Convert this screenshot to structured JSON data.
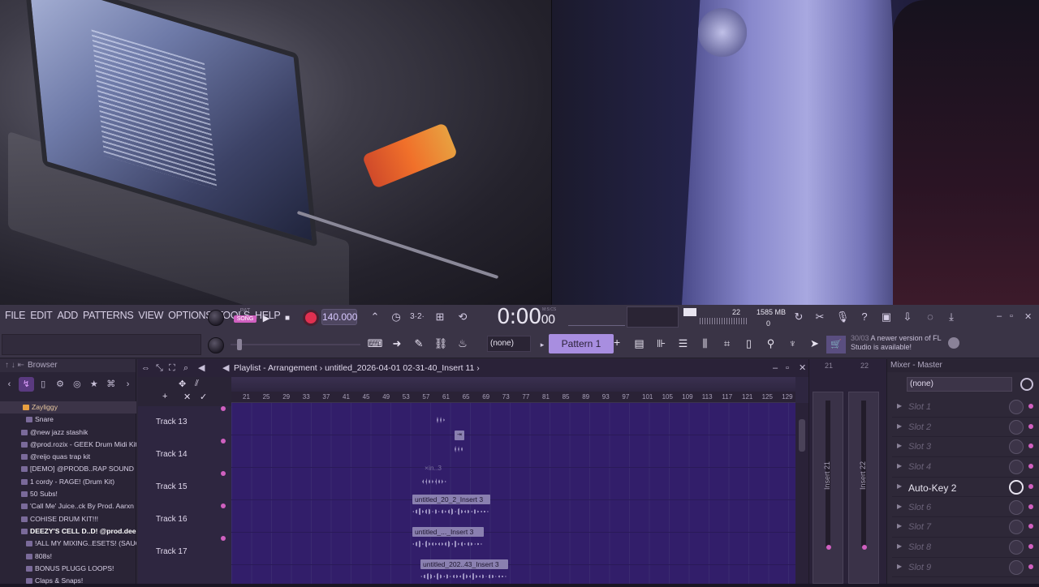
{
  "menu": [
    "FILE",
    "EDIT",
    "ADD",
    "PATTERNS",
    "VIEW",
    "OPTIONS",
    "TOOLS",
    "HELP"
  ],
  "transport": {
    "pat_label": "PAT",
    "song_label": "SONG",
    "tempo": "140.000",
    "time_main": "0:00",
    "time_sub": "00",
    "time_unit": "M:S:CS"
  },
  "perf": {
    "cpu": "22",
    "memory": "1585 MB",
    "polyphony": "0"
  },
  "snap": "(none)",
  "pattern": "Pattern 1",
  "news": {
    "date": "30/03",
    "text": "A newer version of FL Studio is available!"
  },
  "browser": {
    "title": "Browser",
    "items": [
      "Zayliggy",
      "Snare",
      "@new jazz stashik",
      "@prod.rozix - GEEK Drum Midi Kit",
      "@reijo quas trap kit",
      "[DEMO] @PRODB..RAP SOUND KIT",
      "1 cordy - RAGE! (Drum Kit)",
      "50 Subs!",
      "'Call Me' Juice..ck By Prod. Aarxn",
      "COHISE DRUM KIT!!!",
      "DEEZY'S CELL D..D! @prod.deezy",
      "!ALL MY MIXING..ESETS! (SAUCE)",
      "808s!",
      "BONUS PLUGG LOOPS!",
      "Claps & Snaps!"
    ]
  },
  "playlist": {
    "title": "Playlist - Arrangement",
    "file": "untitled_2026-04-01 02-31-40_Insert 11",
    "bars": [
      "21",
      "25",
      "29",
      "33",
      "37",
      "41",
      "45",
      "49",
      "53",
      "57",
      "61",
      "65",
      "69",
      "73",
      "77",
      "81",
      "85",
      "89",
      "93",
      "97",
      "101",
      "105",
      "109",
      "113",
      "117",
      "121",
      "125",
      "129"
    ],
    "tracks": [
      "Track 13",
      "Track 14",
      "Track 15",
      "Track 16",
      "Track 17"
    ],
    "clips": [
      "untitled_20_2_Insert 3",
      "untitled_..._Insert 3",
      "untitled_202..43_Insert 3"
    ],
    "ghost_clip": "×in..3"
  },
  "mixer_strip": {
    "inserts": [
      "Insert 21",
      "Insert 22"
    ],
    "numbers": [
      "21",
      "22"
    ]
  },
  "mixer": {
    "title": "Mixer - Master",
    "preset": "(none)",
    "slots": [
      "Slot 1",
      "Slot 2",
      "Slot 3",
      "Slot 4",
      "Auto-Key 2",
      "Slot 6",
      "Slot 7",
      "Slot 8",
      "Slot 9"
    ]
  }
}
